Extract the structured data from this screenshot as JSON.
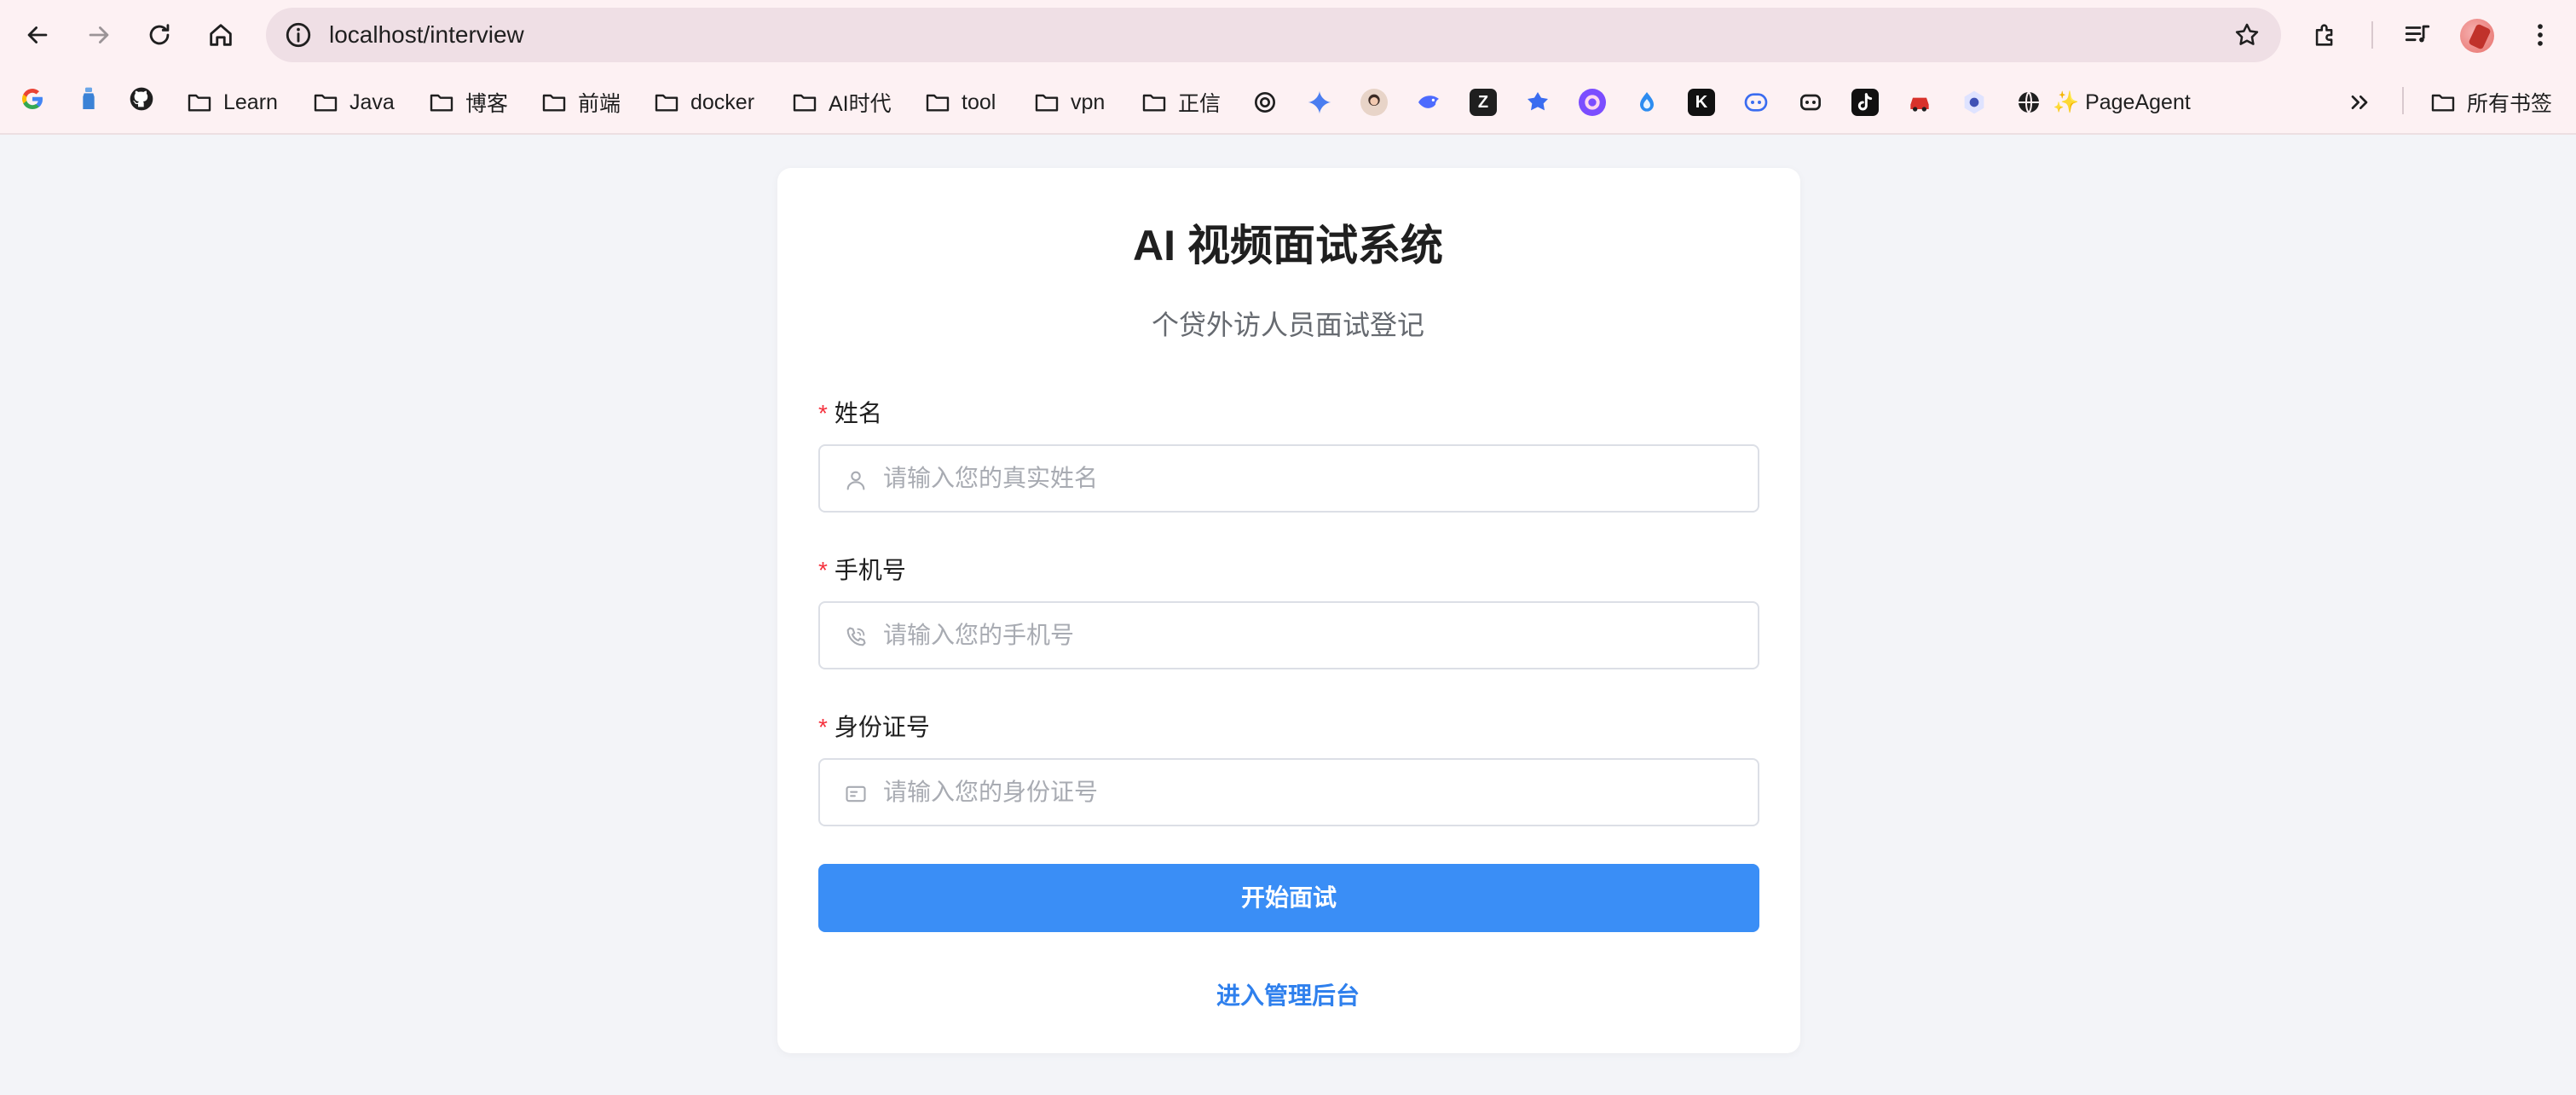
{
  "browser": {
    "url_host": "localhost",
    "url_path": "/interview",
    "bookmarks": [
      {
        "label": "Learn",
        "type": "folder"
      },
      {
        "label": "Java",
        "type": "folder"
      },
      {
        "label": "博客",
        "type": "folder"
      },
      {
        "label": "前端",
        "type": "folder"
      },
      {
        "label": "docker",
        "type": "folder"
      },
      {
        "label": "AI时代",
        "type": "folder"
      },
      {
        "label": "tool",
        "type": "folder"
      },
      {
        "label": "vpn",
        "type": "folder"
      },
      {
        "label": "正信",
        "type": "folder"
      }
    ],
    "page_agent_label": "✨ PageAgent",
    "all_bookmarks_label": "所有书签"
  },
  "page": {
    "title": "AI 视频面试系统",
    "subtitle": "个贷外访人员面试登记",
    "fields": [
      {
        "label": "姓名",
        "required": "*",
        "placeholder": "请输入您的真实姓名",
        "value": "",
        "icon": "user-icon"
      },
      {
        "label": "手机号",
        "required": "*",
        "placeholder": "请输入您的手机号",
        "value": "",
        "icon": "phone-icon"
      },
      {
        "label": "身份证号",
        "required": "*",
        "placeholder": "请输入您的身份证号",
        "value": "",
        "icon": "id-card-icon"
      }
    ],
    "submit_label": "开始面试",
    "admin_link": "进入管理后台"
  },
  "colors": {
    "primary": "#3a8ef6",
    "link": "#2f80ed",
    "required": "#f5313d",
    "page_bg": "#f3f4f8",
    "chrome_bg": "#fdf1f3"
  }
}
